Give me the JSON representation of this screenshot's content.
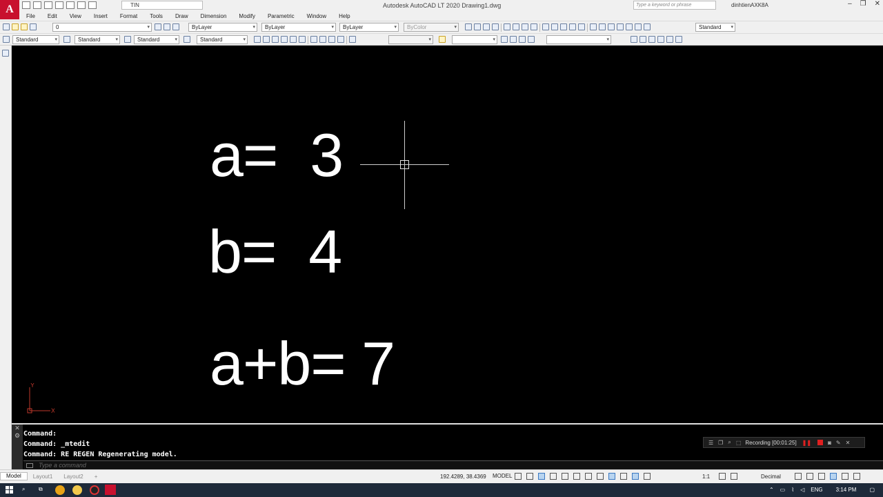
{
  "titlebar": {
    "logo": "A",
    "workspace": "TIN",
    "app_title": "Autodesk AutoCAD LT 2020    Drawing1.dwg",
    "search_placeholder": "Type a keyword or phrase",
    "user": "dinhtienAXK8A",
    "window_controls": [
      "–",
      "❐",
      "✕"
    ]
  },
  "menu": [
    "File",
    "Edit",
    "View",
    "Insert",
    "Format",
    "Tools",
    "Draw",
    "Dimension",
    "Modify",
    "Parametric",
    "Window",
    "Help"
  ],
  "toolbar1": {
    "layer": "0",
    "color": "ByLayer",
    "linetype": "ByLayer",
    "lineweight": "ByLayer",
    "plotstyle": "ByColor",
    "dimstyle": "Standard"
  },
  "toolbar2": {
    "textstyle": "Standard",
    "dim_style": "Standard",
    "table_style": "Standard",
    "mleader_style": "Standard"
  },
  "canvas": {
    "lines": [
      "a=  3",
      "b=  4",
      "a+b= 7"
    ],
    "ucs_y": "Y",
    "ucs_x": "X"
  },
  "command": {
    "history": [
      "Command:",
      "Command: _mtedit",
      "Command: RE REGEN Regenerating model."
    ],
    "placeholder": "Type a command"
  },
  "recording": {
    "label": "Recording [00:01:25]"
  },
  "tabs": [
    "Model",
    "Layout1",
    "Layout2",
    "+"
  ],
  "status": {
    "coords": "192.4289, 38.4369",
    "space": "MODEL",
    "scale": "1:1",
    "units": "Decimal"
  },
  "taskbar": {
    "lang": "ENG",
    "time": "3:14 PM"
  },
  "colors": {
    "accent": "#c8102e",
    "canvas": "#000000",
    "recording": "#e02020"
  }
}
